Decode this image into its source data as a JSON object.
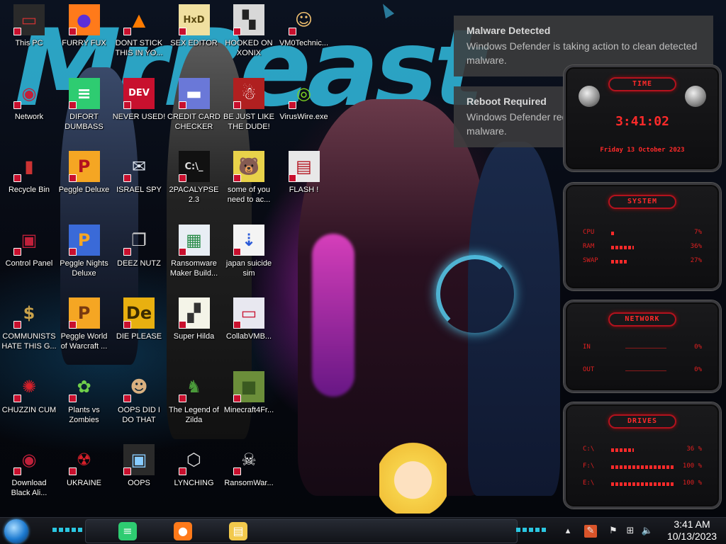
{
  "icons": [
    {
      "label": "This PC",
      "glyph": "▭",
      "bg": "#2a2a2a",
      "fg": "#c33",
      "col": 0,
      "row": 0
    },
    {
      "label": "FURRY FUX",
      "glyph": "●",
      "bg": "#ff7a1a",
      "fg": "#5b2fd8",
      "col": 1,
      "row": 0
    },
    {
      "label": "DONT STICK THIS IN YO...",
      "glyph": "▲",
      "bg": "transparent",
      "fg": "#ff7b00",
      "col": 2,
      "row": 0
    },
    {
      "label": "SEX EDITOR",
      "glyph": "HxD",
      "bg": "#f0e0a0",
      "fg": "#5a4a10",
      "col": 3,
      "row": 0
    },
    {
      "label": "HOOKED ON XONIX",
      "glyph": "▚",
      "bg": "#d8d8d8",
      "fg": "#222",
      "col": 4,
      "row": 0
    },
    {
      "label": "VM0Technic...",
      "glyph": "☺",
      "bg": "transparent",
      "fg": "#f0c070",
      "col": 5,
      "row": 0
    },
    {
      "label": "Network",
      "glyph": "◉",
      "bg": "transparent",
      "fg": "#c0203a",
      "col": 0,
      "row": 1
    },
    {
      "label": "DIFORT DUMBASS",
      "glyph": "≡",
      "bg": "#2ecc71",
      "fg": "#fff",
      "col": 1,
      "row": 1
    },
    {
      "label": "NEVER USED!",
      "glyph": "DEV",
      "bg": "#c8102e",
      "fg": "#fff",
      "col": 2,
      "row": 1
    },
    {
      "label": "CREDIT CARD CHECKER",
      "glyph": "▬",
      "bg": "#6a78d8",
      "fg": "#fff",
      "col": 3,
      "row": 1
    },
    {
      "label": "BE JUST LIKE THE DUDE!",
      "glyph": "☃",
      "bg": "#b02020",
      "fg": "#fff",
      "col": 4,
      "row": 1
    },
    {
      "label": "VirusWire.exe",
      "glyph": "◎",
      "bg": "transparent",
      "fg": "#7fd321",
      "col": 5,
      "row": 1
    },
    {
      "label": "Recycle Bin",
      "glyph": "▮",
      "bg": "transparent",
      "fg": "#c33",
      "col": 0,
      "row": 2
    },
    {
      "label": "Peggle Deluxe",
      "glyph": "P",
      "bg": "#f5a623",
      "fg": "#b3121e",
      "col": 1,
      "row": 2
    },
    {
      "label": "ISRAEL SPY",
      "glyph": "✉",
      "bg": "transparent",
      "fg": "#dfe6f0",
      "col": 2,
      "row": 2
    },
    {
      "label": "2PACALYPSE 2.3",
      "glyph": "C:\\_",
      "bg": "#111",
      "fg": "#ddd",
      "col": 3,
      "row": 2
    },
    {
      "label": "some of you need to ac...",
      "glyph": "🐻",
      "bg": "#e8d24a",
      "fg": "#7a3a10",
      "col": 4,
      "row": 2
    },
    {
      "label": "FLASH !",
      "glyph": "▤",
      "bg": "#e8e8e8",
      "fg": "#b3121e",
      "col": 5,
      "row": 2
    },
    {
      "label": "Control Panel",
      "glyph": "▣",
      "bg": "transparent",
      "fg": "#c0203a",
      "col": 0,
      "row": 3
    },
    {
      "label": "Peggle Nights Deluxe",
      "glyph": "P",
      "bg": "#3a6ad8",
      "fg": "#f5a623",
      "col": 1,
      "row": 3
    },
    {
      "label": "DEEZ NUTZ",
      "glyph": "❐",
      "bg": "transparent",
      "fg": "#cfcfcf",
      "col": 2,
      "row": 3
    },
    {
      "label": "Ransomware Maker Build...",
      "glyph": "▦",
      "bg": "#e8eef4",
      "fg": "#2a8c4a",
      "col": 3,
      "row": 3
    },
    {
      "label": "japan suicide sim",
      "glyph": "⇣",
      "bg": "#f4f4f4",
      "fg": "#2a5ad8",
      "col": 4,
      "row": 3
    },
    {
      "label": "COMMUNISTS HATE THIS G...",
      "glyph": "$",
      "bg": "transparent",
      "fg": "#c9a24a",
      "col": 0,
      "row": 4
    },
    {
      "label": "Peggle World of Warcraft ...",
      "glyph": "P",
      "bg": "#f5a623",
      "fg": "#7a3a10",
      "col": 1,
      "row": 4
    },
    {
      "label": "DIE PLEASE",
      "glyph": "De",
      "bg": "#e8b010",
      "fg": "#3a2a00",
      "col": 2,
      "row": 4
    },
    {
      "label": "Super Hilda",
      "glyph": "▞",
      "bg": "#f4f4e8",
      "fg": "#333",
      "col": 3,
      "row": 4
    },
    {
      "label": "CollabVMB...",
      "glyph": "▭",
      "bg": "#e8e8f0",
      "fg": "#c8102e",
      "col": 4,
      "row": 4
    },
    {
      "label": "CHUZZIN CUM",
      "glyph": "✺",
      "bg": "transparent",
      "fg": "#d8202a",
      "col": 0,
      "row": 5
    },
    {
      "label": "Plants vs Zombies",
      "glyph": "✿",
      "bg": "transparent",
      "fg": "#6fcf4a",
      "col": 1,
      "row": 5
    },
    {
      "label": "OOPS DID I DO THAT",
      "glyph": "☻",
      "bg": "transparent",
      "fg": "#d8b080",
      "col": 2,
      "row": 5
    },
    {
      "label": "The Legend of Zilda",
      "glyph": "♞",
      "bg": "transparent",
      "fg": "#4a9a3a",
      "col": 3,
      "row": 5
    },
    {
      "label": "Minecraft4Fr...",
      "glyph": "■",
      "bg": "#6b8e3a",
      "fg": "#3a5a20",
      "col": 4,
      "row": 5
    },
    {
      "label": "Download Black Ali...",
      "glyph": "◉",
      "bg": "transparent",
      "fg": "#c0203a",
      "col": 0,
      "row": 6
    },
    {
      "label": "UKRAINE",
      "glyph": "☢",
      "bg": "transparent",
      "fg": "#d8202a",
      "col": 1,
      "row": 6
    },
    {
      "label": "OOPS",
      "glyph": "▣",
      "bg": "#2a2a2a",
      "fg": "#8cf",
      "col": 2,
      "row": 6
    },
    {
      "label": "LYNCHING",
      "glyph": "⬡",
      "bg": "transparent",
      "fg": "#ddd",
      "col": 3,
      "row": 6
    },
    {
      "label": "RansomWar...",
      "glyph": "☠",
      "bg": "transparent",
      "fg": "#eee",
      "col": 4,
      "row": 6
    }
  ],
  "wallpaper": {
    "text": "MrBeast"
  },
  "notifications": [
    {
      "title": "Malware Detected",
      "body": "Windows Defender is taking action to clean detected malware."
    },
    {
      "title": "Reboot Required",
      "body": "Windows Defender requires a reboot to clean malware."
    }
  ],
  "widgets": {
    "time": {
      "header": "TIME",
      "time": "3:41:02",
      "date": "Friday 13 October 2023"
    },
    "system": {
      "header": "SYSTEM",
      "rows": [
        {
          "label": "CPU",
          "value": "7%",
          "fill": 0.07
        },
        {
          "label": "RAM",
          "value": "36%",
          "fill": 0.36
        },
        {
          "label": "SWAP",
          "value": "27%",
          "fill": 0.27
        }
      ]
    },
    "network": {
      "header": "NETWORK",
      "rows": [
        {
          "label": "IN",
          "value": "0%"
        },
        {
          "label": "OUT",
          "value": "0%"
        }
      ]
    },
    "drives": {
      "header": "DRIVES",
      "rows": [
        {
          "label": "C:\\",
          "value": "36 %",
          "fill": 0.36
        },
        {
          "label": "F:\\",
          "value": "100 %",
          "fill": 1.0
        },
        {
          "label": "E:\\",
          "value": "100 %",
          "fill": 1.0
        }
      ]
    }
  },
  "taskbar": {
    "pinned": [
      {
        "name": "app-green",
        "glyph": "≡",
        "color": "#2ecc71"
      },
      {
        "name": "firefox",
        "glyph": "●",
        "color": "#ff7a1a"
      },
      {
        "name": "file-explorer",
        "glyph": "▤",
        "color": "#f2c94c"
      }
    ],
    "clock": {
      "time": "3:41 AM",
      "date": "10/13/2023"
    }
  },
  "colors": {
    "accent": "#2fb3d6",
    "widget_red": "#ff2a2a",
    "toast_bg": "#3c3c3e"
  }
}
